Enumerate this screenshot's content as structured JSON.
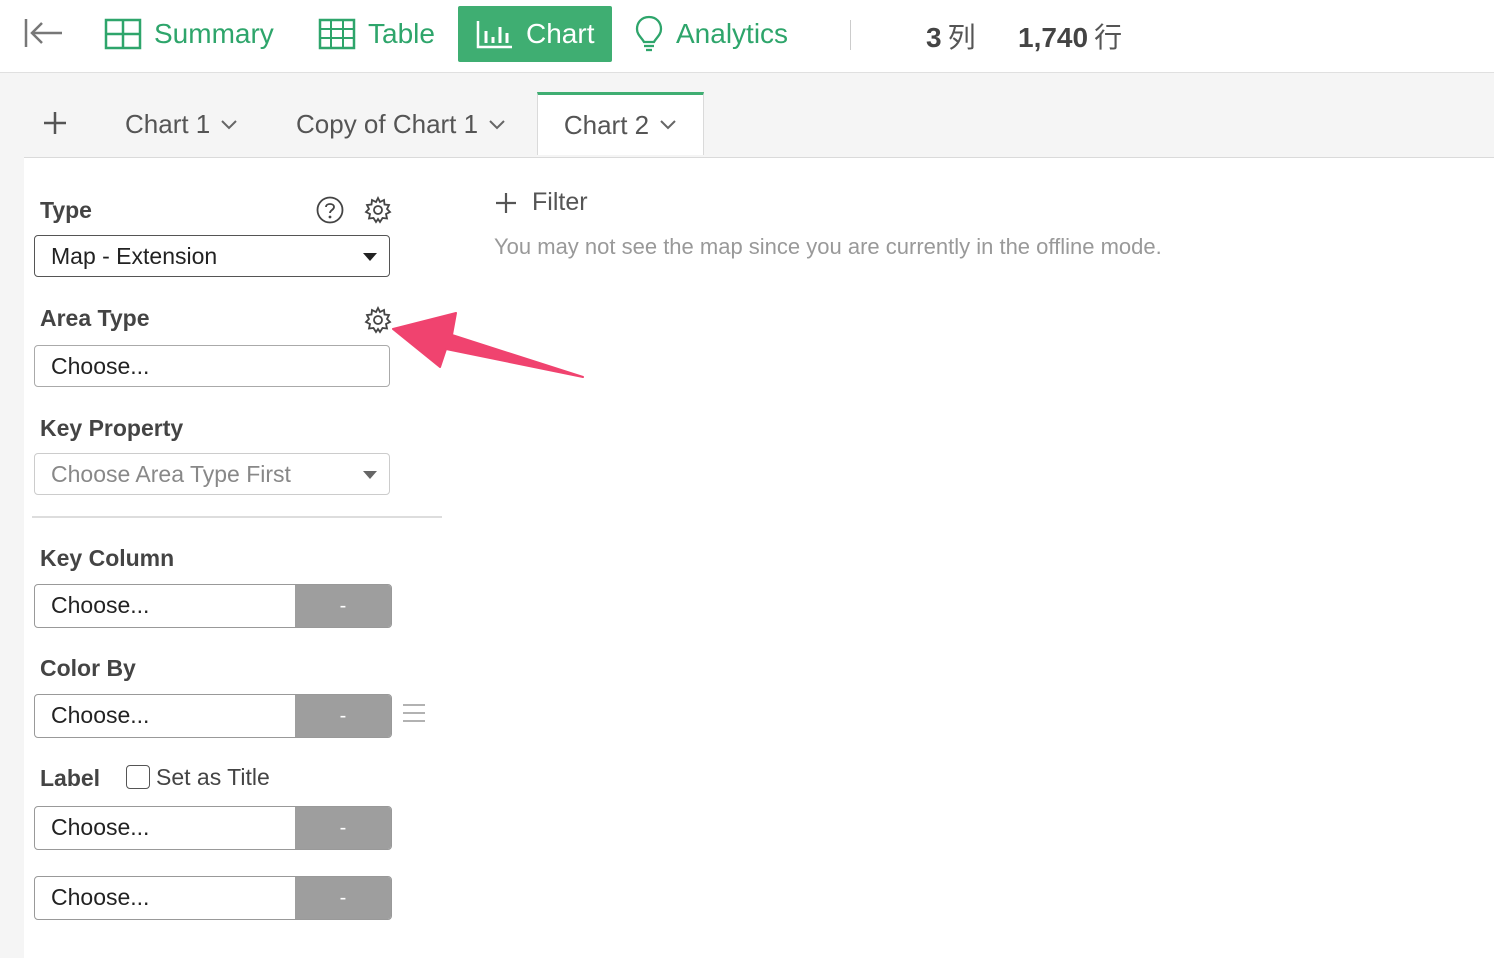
{
  "nav": {
    "tabs": [
      {
        "label": "Summary",
        "icon": "grid-icon"
      },
      {
        "label": "Table",
        "icon": "table-icon"
      },
      {
        "label": "Chart",
        "icon": "bar-chart-icon",
        "active": true
      },
      {
        "label": "Analytics",
        "icon": "lightbulb-icon"
      }
    ],
    "columns_count": "3",
    "columns_unit": "列",
    "rows_count": "1,740",
    "rows_unit": "行"
  },
  "chart_tabs": [
    {
      "label": "Chart 1"
    },
    {
      "label": "Copy of Chart 1"
    },
    {
      "label": "Chart 2",
      "active": true
    }
  ],
  "config": {
    "type_label": "Type",
    "type_value": "Map - Extension",
    "area_type_label": "Area Type",
    "area_type_placeholder": "Choose...",
    "key_property_label": "Key Property",
    "key_property_value": "Choose Area Type First",
    "key_column_label": "Key Column",
    "key_column_value": "Choose...",
    "key_column_button": "-",
    "color_by_label": "Color By",
    "color_by_value": "Choose...",
    "color_by_button": "-",
    "label_label": "Label",
    "set_as_title_label": "Set as Title",
    "label_value_1": "Choose...",
    "label_button_1": "-",
    "label_value_2": "Choose...",
    "label_button_2": "-"
  },
  "main": {
    "filter_label": "Filter",
    "offline_message": "You may not see the map since you are currently in the offline mode."
  },
  "colors": {
    "accent": "#3fae72",
    "annotation_arrow": "#f0436f"
  }
}
